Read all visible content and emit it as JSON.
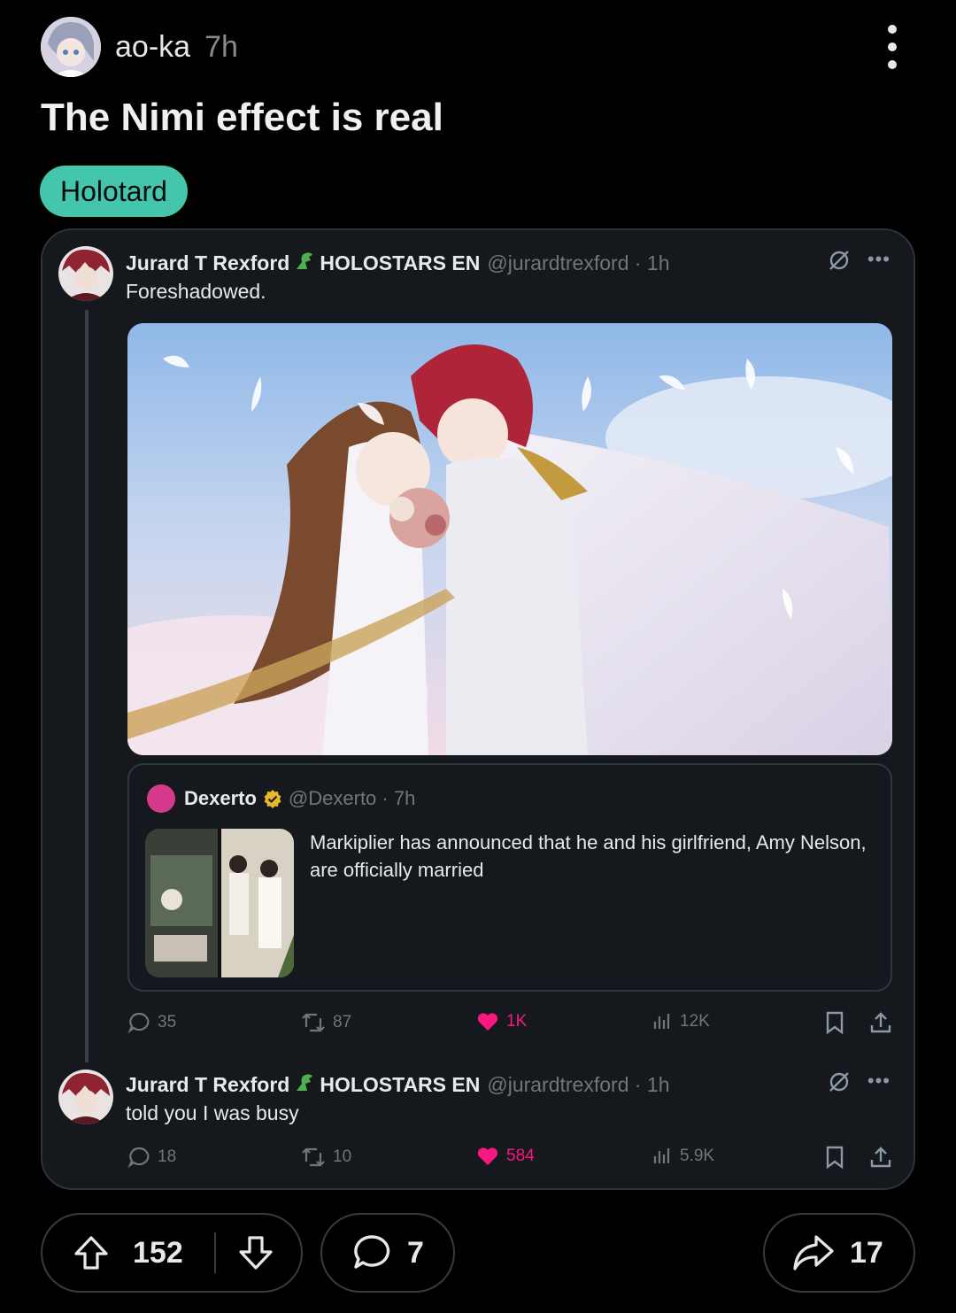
{
  "post": {
    "author": "ao-ka",
    "time": "7h",
    "title": "The Nimi effect is real",
    "flair": "Holotard",
    "flair_color": "#43c6ac"
  },
  "tweet1": {
    "name": "Jurard T Rexford",
    "org": "HOLOSTARS EN",
    "handle": "@jurardtrexford · 1h",
    "text": "Foreshadowed.",
    "quote": {
      "name": "Dexerto",
      "handle": "@Dexerto · 7h",
      "text": "Markiplier has announced that he and his girlfriend, Amy Nelson, are officially married"
    },
    "stats": {
      "replies": "35",
      "retweets": "87",
      "likes": "1K",
      "views": "12K"
    }
  },
  "tweet2": {
    "name": "Jurard T Rexford",
    "org": "HOLOSTARS EN",
    "handle": "@jurardtrexford · 1h",
    "text": "told you I was busy",
    "stats": {
      "replies": "18",
      "retweets": "10",
      "likes": "584",
      "views": "5.9K"
    }
  },
  "footer": {
    "upvotes": "152",
    "comments": "7",
    "shares": "17"
  },
  "colors": {
    "like": "#f91880",
    "card_bg": "#15181d",
    "page_bg": "#000000"
  },
  "icons": [
    "more-vertical-icon",
    "grok-icon",
    "reply-icon",
    "retweet-icon",
    "heart-icon",
    "views-icon",
    "bookmark-icon",
    "share-upload-icon",
    "upvote-icon",
    "downvote-icon",
    "comment-icon",
    "share-arrow-icon"
  ]
}
